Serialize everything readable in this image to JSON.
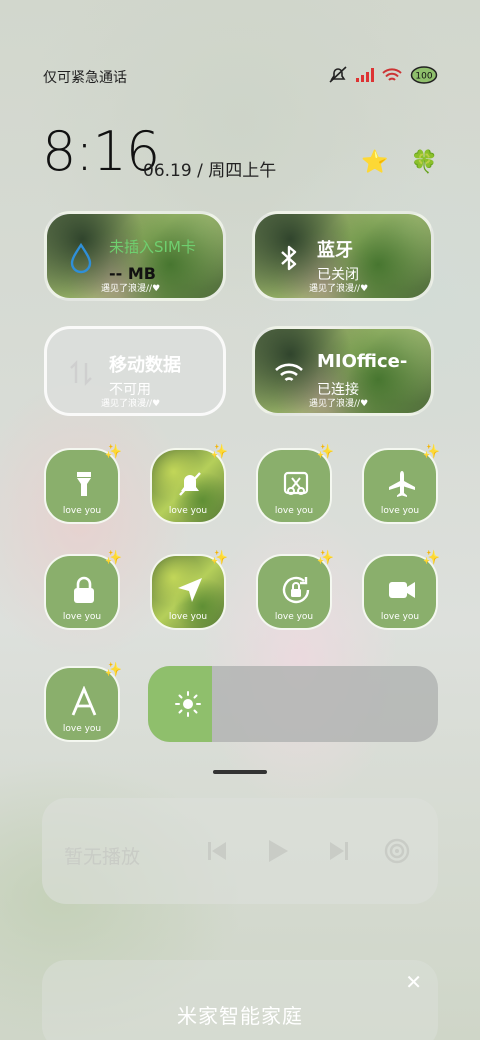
{
  "status_bar": {
    "carrier": "仅可紧急通话",
    "battery": "100"
  },
  "clock": {
    "time": "8:16",
    "date": "06.19 / 周四上午"
  },
  "top_icons": [
    "star-icon",
    "clover-icon"
  ],
  "tiles": {
    "sim": {
      "title": "未插入SIM卡",
      "sub": "-- MB",
      "foot": "遇见了浪漫//♥"
    },
    "bluetooth": {
      "title": "蓝牙",
      "sub": "已关闭",
      "foot": "遇见了浪漫//♥"
    },
    "mobile_data": {
      "title": "移动数据",
      "sub": "不可用",
      "foot": "遇见了浪漫//♥"
    },
    "wifi": {
      "title": "MIOffice-",
      "sub": "已连接",
      "foot": "遇见了浪漫//♥"
    }
  },
  "toggles": [
    {
      "name": "flashlight",
      "label": "love you"
    },
    {
      "name": "silent",
      "label": "love you"
    },
    {
      "name": "screenshot",
      "label": "love you"
    },
    {
      "name": "airplane",
      "label": "love you"
    },
    {
      "name": "lock",
      "label": "love you"
    },
    {
      "name": "location",
      "label": "love you"
    },
    {
      "name": "rotation-lock",
      "label": "love you"
    },
    {
      "name": "screen-record",
      "label": "love you"
    },
    {
      "name": "auto-brightness",
      "label": "love you"
    }
  ],
  "brightness": {
    "level": 0.22
  },
  "media": {
    "title": "暂无播放"
  },
  "smart_home": {
    "title": "米家智能家庭"
  },
  "colors": {
    "accent_green": "#8aaf6c",
    "brightness_fill": "#8fbf6c"
  }
}
